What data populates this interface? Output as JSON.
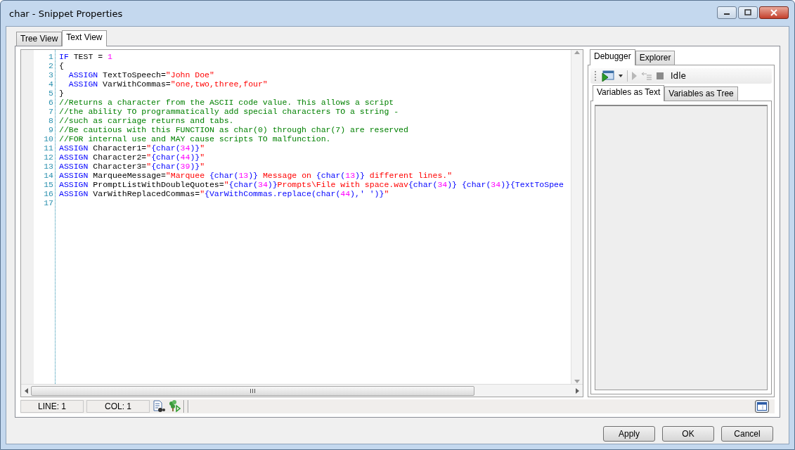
{
  "window": {
    "title": "char - Snippet Properties"
  },
  "tabs": [
    {
      "label": "Tree View",
      "selected": false
    },
    {
      "label": "Text View",
      "selected": true
    }
  ],
  "editor": {
    "lines": [
      {
        "number": "1",
        "tokens": [
          {
            "kind": "kw",
            "text": "IF"
          },
          {
            "kind": "plain",
            "text": " TEST = "
          },
          {
            "kind": "num",
            "text": "1"
          }
        ]
      },
      {
        "number": "2",
        "tokens": [
          {
            "kind": "plain",
            "text": "{"
          }
        ]
      },
      {
        "number": "3",
        "tokens": [
          {
            "kind": "kw",
            "text": "  ASSIGN"
          },
          {
            "kind": "plain",
            "text": " TextToSpeech="
          },
          {
            "kind": "str",
            "text": "\"John Doe\""
          }
        ]
      },
      {
        "number": "4",
        "tokens": [
          {
            "kind": "kw",
            "text": "  ASSIGN"
          },
          {
            "kind": "plain",
            "text": " VarWithCommas="
          },
          {
            "kind": "str",
            "text": "\"one,two,three,four\""
          }
        ]
      },
      {
        "number": "5",
        "tokens": [
          {
            "kind": "plain",
            "text": "}"
          }
        ]
      },
      {
        "number": "6",
        "tokens": [
          {
            "kind": "cmt",
            "text": "//Returns a character from the ASCII code value. This allows a script"
          }
        ]
      },
      {
        "number": "7",
        "tokens": [
          {
            "kind": "cmt",
            "text": "//the ability TO programmatically add special characters TO a string -"
          }
        ]
      },
      {
        "number": "8",
        "tokens": [
          {
            "kind": "cmt",
            "text": "//such as carriage returns and tabs."
          }
        ]
      },
      {
        "number": "9",
        "tokens": [
          {
            "kind": "cmt",
            "text": "//Be cautious with this FUNCTION as char(0) through char(7) are reserved"
          }
        ]
      },
      {
        "number": "10",
        "tokens": [
          {
            "kind": "cmt",
            "text": "//FOR internal use and MAY cause scripts TO malfunction."
          }
        ]
      },
      {
        "number": "11",
        "tokens": [
          {
            "kind": "kw",
            "text": "ASSIGN"
          },
          {
            "kind": "plain",
            "text": " Character1="
          },
          {
            "kind": "str",
            "text": "\""
          },
          {
            "kind": "kw",
            "text": "{char("
          },
          {
            "kind": "num",
            "text": "34"
          },
          {
            "kind": "kw",
            "text": ")}"
          },
          {
            "kind": "str",
            "text": "\""
          }
        ]
      },
      {
        "number": "12",
        "tokens": [
          {
            "kind": "kw",
            "text": "ASSIGN"
          },
          {
            "kind": "plain",
            "text": " Character2="
          },
          {
            "kind": "str",
            "text": "\""
          },
          {
            "kind": "kw",
            "text": "{char("
          },
          {
            "kind": "num",
            "text": "44"
          },
          {
            "kind": "kw",
            "text": ")}"
          },
          {
            "kind": "str",
            "text": "\""
          }
        ]
      },
      {
        "number": "13",
        "tokens": [
          {
            "kind": "kw",
            "text": "ASSIGN"
          },
          {
            "kind": "plain",
            "text": " Character3="
          },
          {
            "kind": "str",
            "text": "\""
          },
          {
            "kind": "kw",
            "text": "{char("
          },
          {
            "kind": "num",
            "text": "39"
          },
          {
            "kind": "kw",
            "text": ")}"
          },
          {
            "kind": "str",
            "text": "\""
          }
        ]
      },
      {
        "number": "14",
        "tokens": [
          {
            "kind": "kw",
            "text": "ASSIGN"
          },
          {
            "kind": "plain",
            "text": " MarqueeMessage="
          },
          {
            "kind": "str",
            "text": "\"Marquee "
          },
          {
            "kind": "kw",
            "text": "{char("
          },
          {
            "kind": "num",
            "text": "13"
          },
          {
            "kind": "kw",
            "text": ")}"
          },
          {
            "kind": "str",
            "text": " Message on "
          },
          {
            "kind": "kw",
            "text": "{char("
          },
          {
            "kind": "num",
            "text": "13"
          },
          {
            "kind": "kw",
            "text": ")}"
          },
          {
            "kind": "str",
            "text": " different lines.\""
          }
        ]
      },
      {
        "number": "15",
        "tokens": [
          {
            "kind": "kw",
            "text": "ASSIGN"
          },
          {
            "kind": "plain",
            "text": " PromptListWithDoubleQuotes="
          },
          {
            "kind": "str",
            "text": "\""
          },
          {
            "kind": "kw",
            "text": "{char("
          },
          {
            "kind": "num",
            "text": "34"
          },
          {
            "kind": "kw",
            "text": ")}"
          },
          {
            "kind": "str",
            "text": "Prompts\\File with space.wav"
          },
          {
            "kind": "kw",
            "text": "{char("
          },
          {
            "kind": "num",
            "text": "34"
          },
          {
            "kind": "kw",
            "text": ")} {char("
          },
          {
            "kind": "num",
            "text": "34"
          },
          {
            "kind": "kw",
            "text": ")}{TextToSpee"
          }
        ]
      },
      {
        "number": "16",
        "tokens": [
          {
            "kind": "kw",
            "text": "ASSIGN"
          },
          {
            "kind": "plain",
            "text": " VarWithReplacedCommas="
          },
          {
            "kind": "str",
            "text": "\""
          },
          {
            "kind": "kw",
            "text": "{VarWithCommas.replace(char("
          },
          {
            "kind": "num",
            "text": "44"
          },
          {
            "kind": "kw",
            "text": "),' ')}"
          },
          {
            "kind": "str",
            "text": "\""
          }
        ]
      },
      {
        "number": "17"
      }
    ]
  },
  "status_bar": {
    "line": "LINE: 1",
    "column": "COL: 1"
  },
  "debugger": {
    "tabs": [
      {
        "label": "Debugger",
        "selected": true
      },
      {
        "label": "Explorer",
        "selected": false
      }
    ],
    "status": "Idle",
    "variable_tabs": [
      {
        "label": "Variables as Text",
        "selected": true
      },
      {
        "label": "Variables as Tree",
        "selected": false
      }
    ]
  },
  "buttons": [
    "Apply",
    "OK",
    "Cancel"
  ]
}
